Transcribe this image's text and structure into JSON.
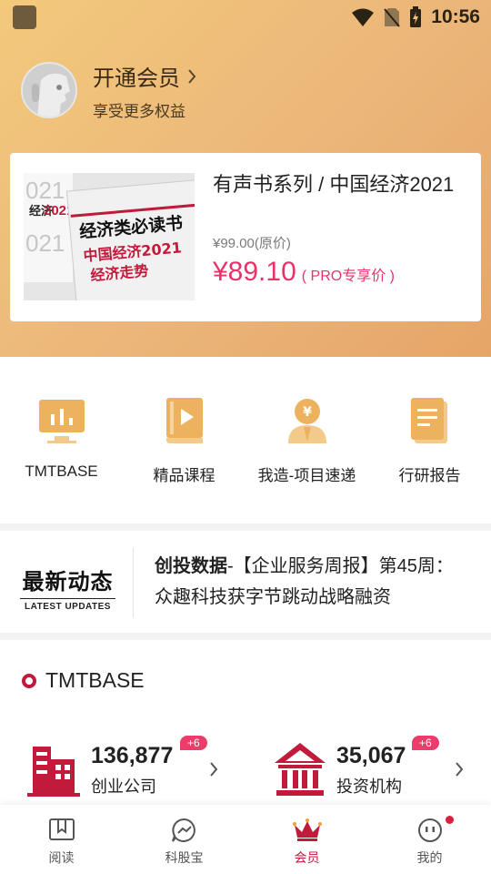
{
  "status_bar": {
    "time": "10:56"
  },
  "profile": {
    "title": "开通会员",
    "subtitle": "享受更多权益"
  },
  "product": {
    "title": "有声书系列 / 中国经济2021",
    "original_price": "¥99.00(原价)",
    "price": "¥89.10",
    "price_tag": "( PRO专享价 )",
    "cover_texts": [
      "经济类必读书",
      "中国经济2021",
      "经济走势",
      "经济",
      "2021"
    ]
  },
  "quick_nav": [
    {
      "label": "TMTBASE",
      "icon": "monitor-chart-icon"
    },
    {
      "label": "精品课程",
      "icon": "video-book-icon"
    },
    {
      "label": "我造-项目速递",
      "icon": "investor-icon"
    },
    {
      "label": "行研报告",
      "icon": "report-icon"
    }
  ],
  "updates": {
    "logo_cn": "最新动态",
    "logo_en": "LATEST UPDATES",
    "source": "创投数据",
    "text": "-【企业服务周报】第45周：众趣科技获字节跳动战略融资"
  },
  "tmtbase": {
    "title": "TMTBASE",
    "stats": [
      {
        "value": "136,877",
        "label": "创业公司",
        "badge": "+6",
        "icon": "building-icon"
      },
      {
        "value": "35,067",
        "label": "投资机构",
        "badge": "+6",
        "icon": "bank-icon"
      }
    ]
  },
  "bottom_nav": [
    {
      "label": "阅读",
      "icon": "book-open-icon",
      "active": false
    },
    {
      "label": "科股宝",
      "icon": "chart-chat-icon",
      "active": false
    },
    {
      "label": "会员",
      "icon": "crown-icon",
      "active": true
    },
    {
      "label": "我的",
      "icon": "smiley-icon",
      "active": false
    }
  ],
  "colors": {
    "accent": "#c21a3a",
    "price": "#e8336a",
    "header_gradient_start": "#f3c97c",
    "header_gradient_end": "#e6a567",
    "icon_gold": "#ecb25e"
  }
}
